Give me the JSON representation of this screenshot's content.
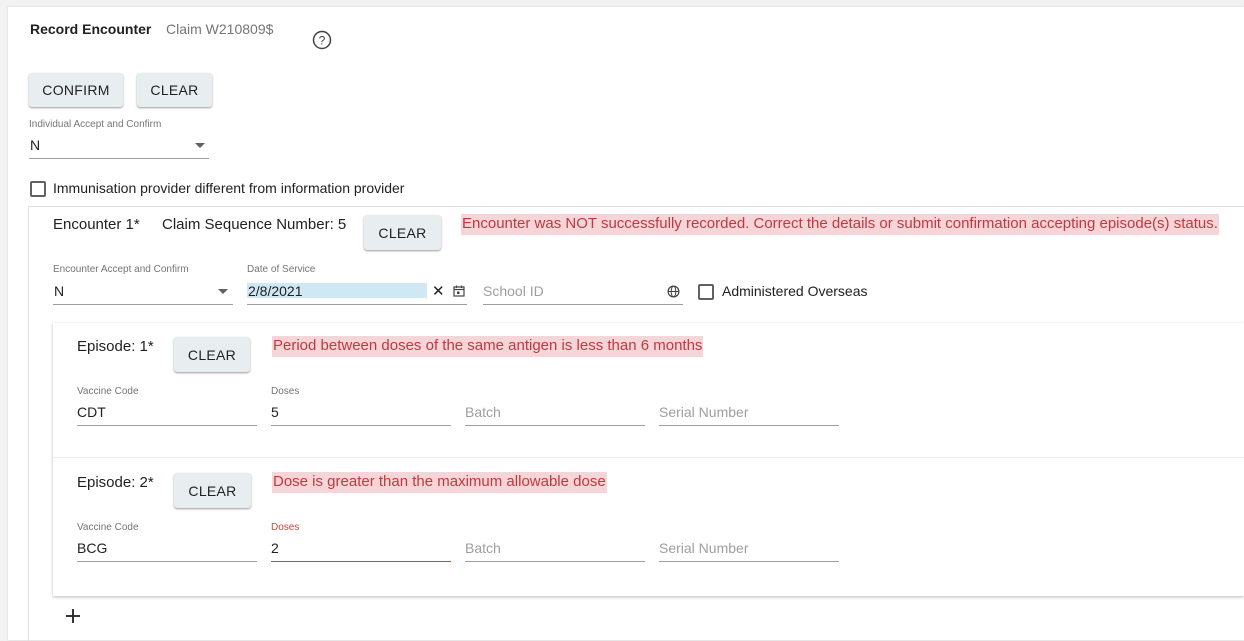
{
  "header": {
    "title": "Record Encounter",
    "claim": "Claim W210809$",
    "help_icon": "help-circle-icon"
  },
  "toolbar": {
    "confirm_label": "CONFIRM",
    "clear_label": "CLEAR"
  },
  "individual_accept": {
    "label": "Individual Accept and Confirm",
    "value": "N"
  },
  "immunisation_checkbox": {
    "label": "Immunisation provider different from information provider",
    "checked": false
  },
  "encounter": {
    "title": "Encounter 1*",
    "sequence": "Claim Sequence Number: 5",
    "clear_label": "CLEAR",
    "error": "Encounter was NOT successfully recorded. Correct the details or submit confirmation accepting episode(s) status.",
    "accept_label": "Encounter Accept and Confirm",
    "accept_value": "N",
    "date_label": "Date of Service",
    "date_value": "2/8/2021",
    "school_placeholder": "School ID",
    "overseas_label": "Administered Overseas",
    "overseas_checked": false
  },
  "episodes": [
    {
      "title": "Episode: 1*",
      "clear_label": "CLEAR",
      "error": "Period between doses of the same antigen is less than 6 months",
      "vaccine_label": "Vaccine Code",
      "vaccine_value": "CDT",
      "doses_label": "Doses",
      "doses_value": "5",
      "batch_placeholder": "Batch",
      "serial_placeholder": "Serial Number"
    },
    {
      "title": "Episode: 2*",
      "clear_label": "CLEAR",
      "error": "Dose is greater than the maximum allowable dose",
      "vaccine_label": "Vaccine Code",
      "vaccine_value": "BCG",
      "doses_label": "Doses",
      "doses_value": "2",
      "batch_placeholder": "Batch",
      "serial_placeholder": "Serial Number"
    }
  ],
  "colors": {
    "error_bg": "#f5d5d7",
    "error_text": "#c0393f",
    "button_bg": "#e8eef0",
    "date_highlight": "#cfe8f3"
  }
}
